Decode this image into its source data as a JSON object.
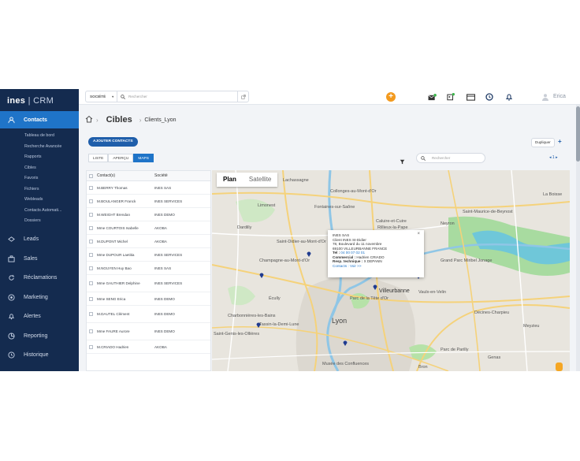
{
  "app": {
    "logo_main": "ines",
    "logo_sub": "CRM"
  },
  "sidebar": {
    "active": "Contacts",
    "subitems": [
      "Tableau de bord",
      "Recherche Avancée",
      "Rapports",
      "Cibles",
      "Favoris",
      "Fichiers",
      "Webleads",
      "Contacts Automati...",
      "Dossiers"
    ],
    "items": [
      "Leads",
      "Sales",
      "Réclamations",
      "Marketing",
      "Alertes",
      "Reporting",
      "Historique"
    ]
  },
  "topbar": {
    "search_scope": "SOCIÉTÉ",
    "search_placeholder": "Rechercher",
    "user": "Erica"
  },
  "page": {
    "title": "Cibles",
    "subtitle": "Clients_Lyon",
    "add_button": "AJOUTER CONTACTS",
    "tabs": [
      "LISTE",
      "APERÇU",
      "MAPS"
    ],
    "active_tab": "MAPS",
    "search_placeholder": "Rechercher",
    "duplicate_button": "Dupliquer",
    "pager": "◂ 1 ▸"
  },
  "table": {
    "headers": [
      "Contact(s)",
      "Société"
    ],
    "rows": [
      [
        "M.BERRY Thomas",
        "INES SAS"
      ],
      [
        "M.BOULANGER Franck",
        "INES SERVICES"
      ],
      [
        "M.WEIGHT Brendan",
        "INES DEMO"
      ],
      [
        "Mme COURTOIS Isabelle",
        "AKOBA"
      ],
      [
        "M.DUPONT Michel",
        "AKOBA"
      ],
      [
        "Mme DUPOUR Laetitia",
        "INES SERVICES"
      ],
      [
        "M.NGUYEN Huy Bao",
        "INES SAS"
      ],
      [
        "Mme GAUTHIER Delphine",
        "INES SERVICES"
      ],
      [
        "Mme SENG Erica",
        "INES DEMO"
      ],
      [
        "M.DAUTEL Clément",
        "INES DEMO"
      ],
      [
        "Mme FAURE Aurore",
        "INES DEMO"
      ],
      [
        "M.CRIADO Hadrien",
        "AKOBA"
      ]
    ]
  },
  "map": {
    "type_buttons": [
      "Plan",
      "Satellite"
    ],
    "labels": {
      "lyon": "Lyon",
      "villeurbanne": "Villeurbanne",
      "vaulx": "Vaulx-en-Velin",
      "bron": "Bron",
      "meyzieu": "Meyzieu",
      "limonest": "Limonest",
      "ecully": "Écully",
      "tassin": "Tassin-la-Demi-Lune",
      "champagne": "Champagne-au-Mont-d'Or",
      "saintdidier": "Saint-Didier-au-Mont-d'Or",
      "fontaines": "Fontaines-sur-Saône",
      "rillieux": "Rillieux-la-Pape",
      "caluire": "Caluire-et-Cuire",
      "genas": "Genas",
      "decines": "Décines-Charpieu",
      "grandparc": "Grand Parc Miribel Jonage",
      "musee": "Musée des Confluences",
      "parctete": "Parc de la Tête d'Or",
      "parilly": "Parc de Parilly",
      "laboisse": "La Boisse",
      "beynost": "Saint-Maurice-de-Beynost",
      "neyron": "Neyron",
      "saintgenis": "Saint-Genis-les-Ollières",
      "lachazenay": "Lachassagne",
      "collonges": "Collonges-au-Mont-d'Or",
      "dardilly": "Dardilly",
      "charbonnieres": "Charbonnières-les-Bains"
    },
    "popup": {
      "company": "INES SAS",
      "client": "Client INES St-Didier",
      "address1": "78, Boulevard du 11 novembre",
      "address2": "69100 VILLEURBANNE FRANCE",
      "tel_label": "Tel :",
      "tel": "04 00 07 02 01",
      "commercial_label": "Commercial :",
      "commercial": "Hadrien CRIADO",
      "resp_label": "Resp. technique :",
      "resp": "X DEPANN",
      "contacts": "Contacts : Voir >>"
    }
  }
}
